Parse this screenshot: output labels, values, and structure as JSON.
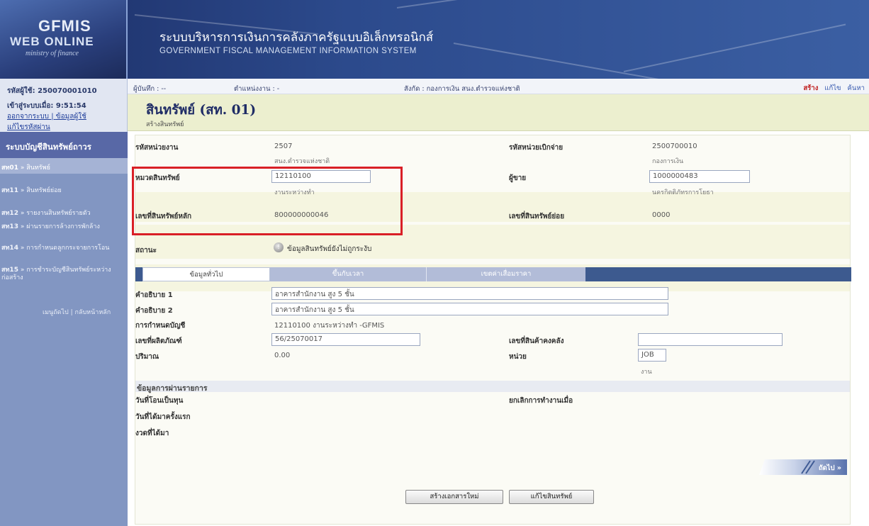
{
  "header": {
    "logo_title": "GFMIS",
    "logo_subtitle": "WEB ONLINE",
    "logo_tagline": "ministry of finance",
    "system_title_th": "ระบบบริหารการเงินการคลังภาครัฐแบบอิเล็กทรอนิกส์",
    "system_title_en": "GOVERNMENT FISCAL MANAGEMENT INFORMATION SYSTEM"
  },
  "sidebar": {
    "user_id_text": "รหัสผู้ใช้: 250070001010",
    "login_time_text": "เข้าสู่ระบบเมื่อ: 9:51:54",
    "links": [
      "ออกจากระบบ",
      "ข้อมูลผู้ใช้",
      "แก้ไขรหัสผ่าน"
    ],
    "link_separator": "|",
    "section_title": "ระบบบัญชีสินทรัพย์ถาวร",
    "items": [
      {
        "code": "สท01",
        "label": "สินทรัพย์"
      },
      {
        "code": "สท11",
        "label": "สินทรัพย์ย่อย"
      },
      {
        "code": "สท12",
        "label": "รายงานสินทรัพย์รายตัว"
      },
      {
        "code": "สท13",
        "label": "ผ่านรายการล้างการพักล้าง"
      },
      {
        "code": "สท14",
        "label": "การกำหนดลูกกระจายการโอน"
      },
      {
        "code": "สท15",
        "label": "การชำระบัญชีสินทรัพย์ระหว่างก่อสร้าง"
      }
    ],
    "arrow": "»",
    "footer_next": "เมนูถัดไป",
    "footer_home": "กลับหน้าหลัก"
  },
  "topbar": {
    "recorder": "ผู้บันทึก : --",
    "position": "ตำแหน่งงาน : -",
    "affiliation": "สังกัด : กองการเงิน สนง.ตำรวจแห่งชาติ",
    "actions": [
      "สร้าง",
      "แก้ไข",
      "ค้นหา"
    ]
  },
  "page": {
    "title": "สินทรัพย์ (สท. 01)",
    "subtitle": "สร้างสินทรัพย์"
  },
  "form": {
    "agency_code_label": "รหัสหน่วยงาน",
    "agency_code": "2507",
    "agency_name": "สนง.ตำรวจแห่งชาติ",
    "disb_unit_label": "รหัสหน่วยเบิกจ่าย",
    "disb_unit": "2500700010",
    "disb_unit_name": "กองการเงิน",
    "asset_group_label": "หมวดสินทรัพย์",
    "asset_group": "12110100",
    "asset_group_name": "งานระหว่างทำ",
    "seller_label": "ผู้ขาย",
    "seller": "1000000483",
    "seller_name": "นครกิตติภัทรการโยธา",
    "main_asset_label": "เลขที่สินทรัพย์หลัก",
    "main_asset": "800000000046",
    "sub_asset_label": "เลขที่สินทรัพย์ย่อย",
    "sub_asset": "0000",
    "status_label": "สถานะ",
    "status_icon": "!",
    "status_text": "ข้อมูลสินทรัพย์ยังไม่ถูกระงับ"
  },
  "tabs": [
    "ข้อมูลทั่วไป",
    "ขึ้นกับเวลา",
    "เขตค่าเสื่อมราคา"
  ],
  "general": {
    "desc1_label": "คำอธิบาย 1",
    "desc1": "อาคารสำนักงาน สูง 5 ชั้น",
    "desc2_label": "คำอธิบาย 2",
    "desc2": "อาคารสำนักงาน สูง 5 ชั้น",
    "account_label": "การกำหนดบัญชี",
    "account": "12110100 งานระหว่างทำ -GFMIS",
    "product_no_label": "เลขที่ผลิตภัณฑ์",
    "product_no": "56/25070017",
    "inventory_no_label": "เลขที่สินค้าคงคลัง",
    "inventory_no": "",
    "quantity_label": "ปริมาณ",
    "quantity": "0.00",
    "unit_label": "หน่วย",
    "unit": "JOB",
    "unit_name": "งาน"
  },
  "posting": {
    "section_title": "ข้อมูลการผ่านรายการ",
    "capitalized_label": "วันที่โอนเป็นทุน",
    "deactivated_label": "ยกเลิกการทำงานเมื่อ",
    "first_acquired_label": "วันที่ได้มาครั้งแรก",
    "period_label": "งวดที่ได้มา"
  },
  "buttons": {
    "next": "ถัดไป »",
    "new_doc": "สร้างเอกสารใหม่",
    "edit_asset": "แก้ไขสินทรัพย์"
  },
  "colors": {
    "header": "#2c4a8c",
    "title_bar": "#ecefcf",
    "highlight": "#d91f26",
    "create_action": "#c02020"
  }
}
